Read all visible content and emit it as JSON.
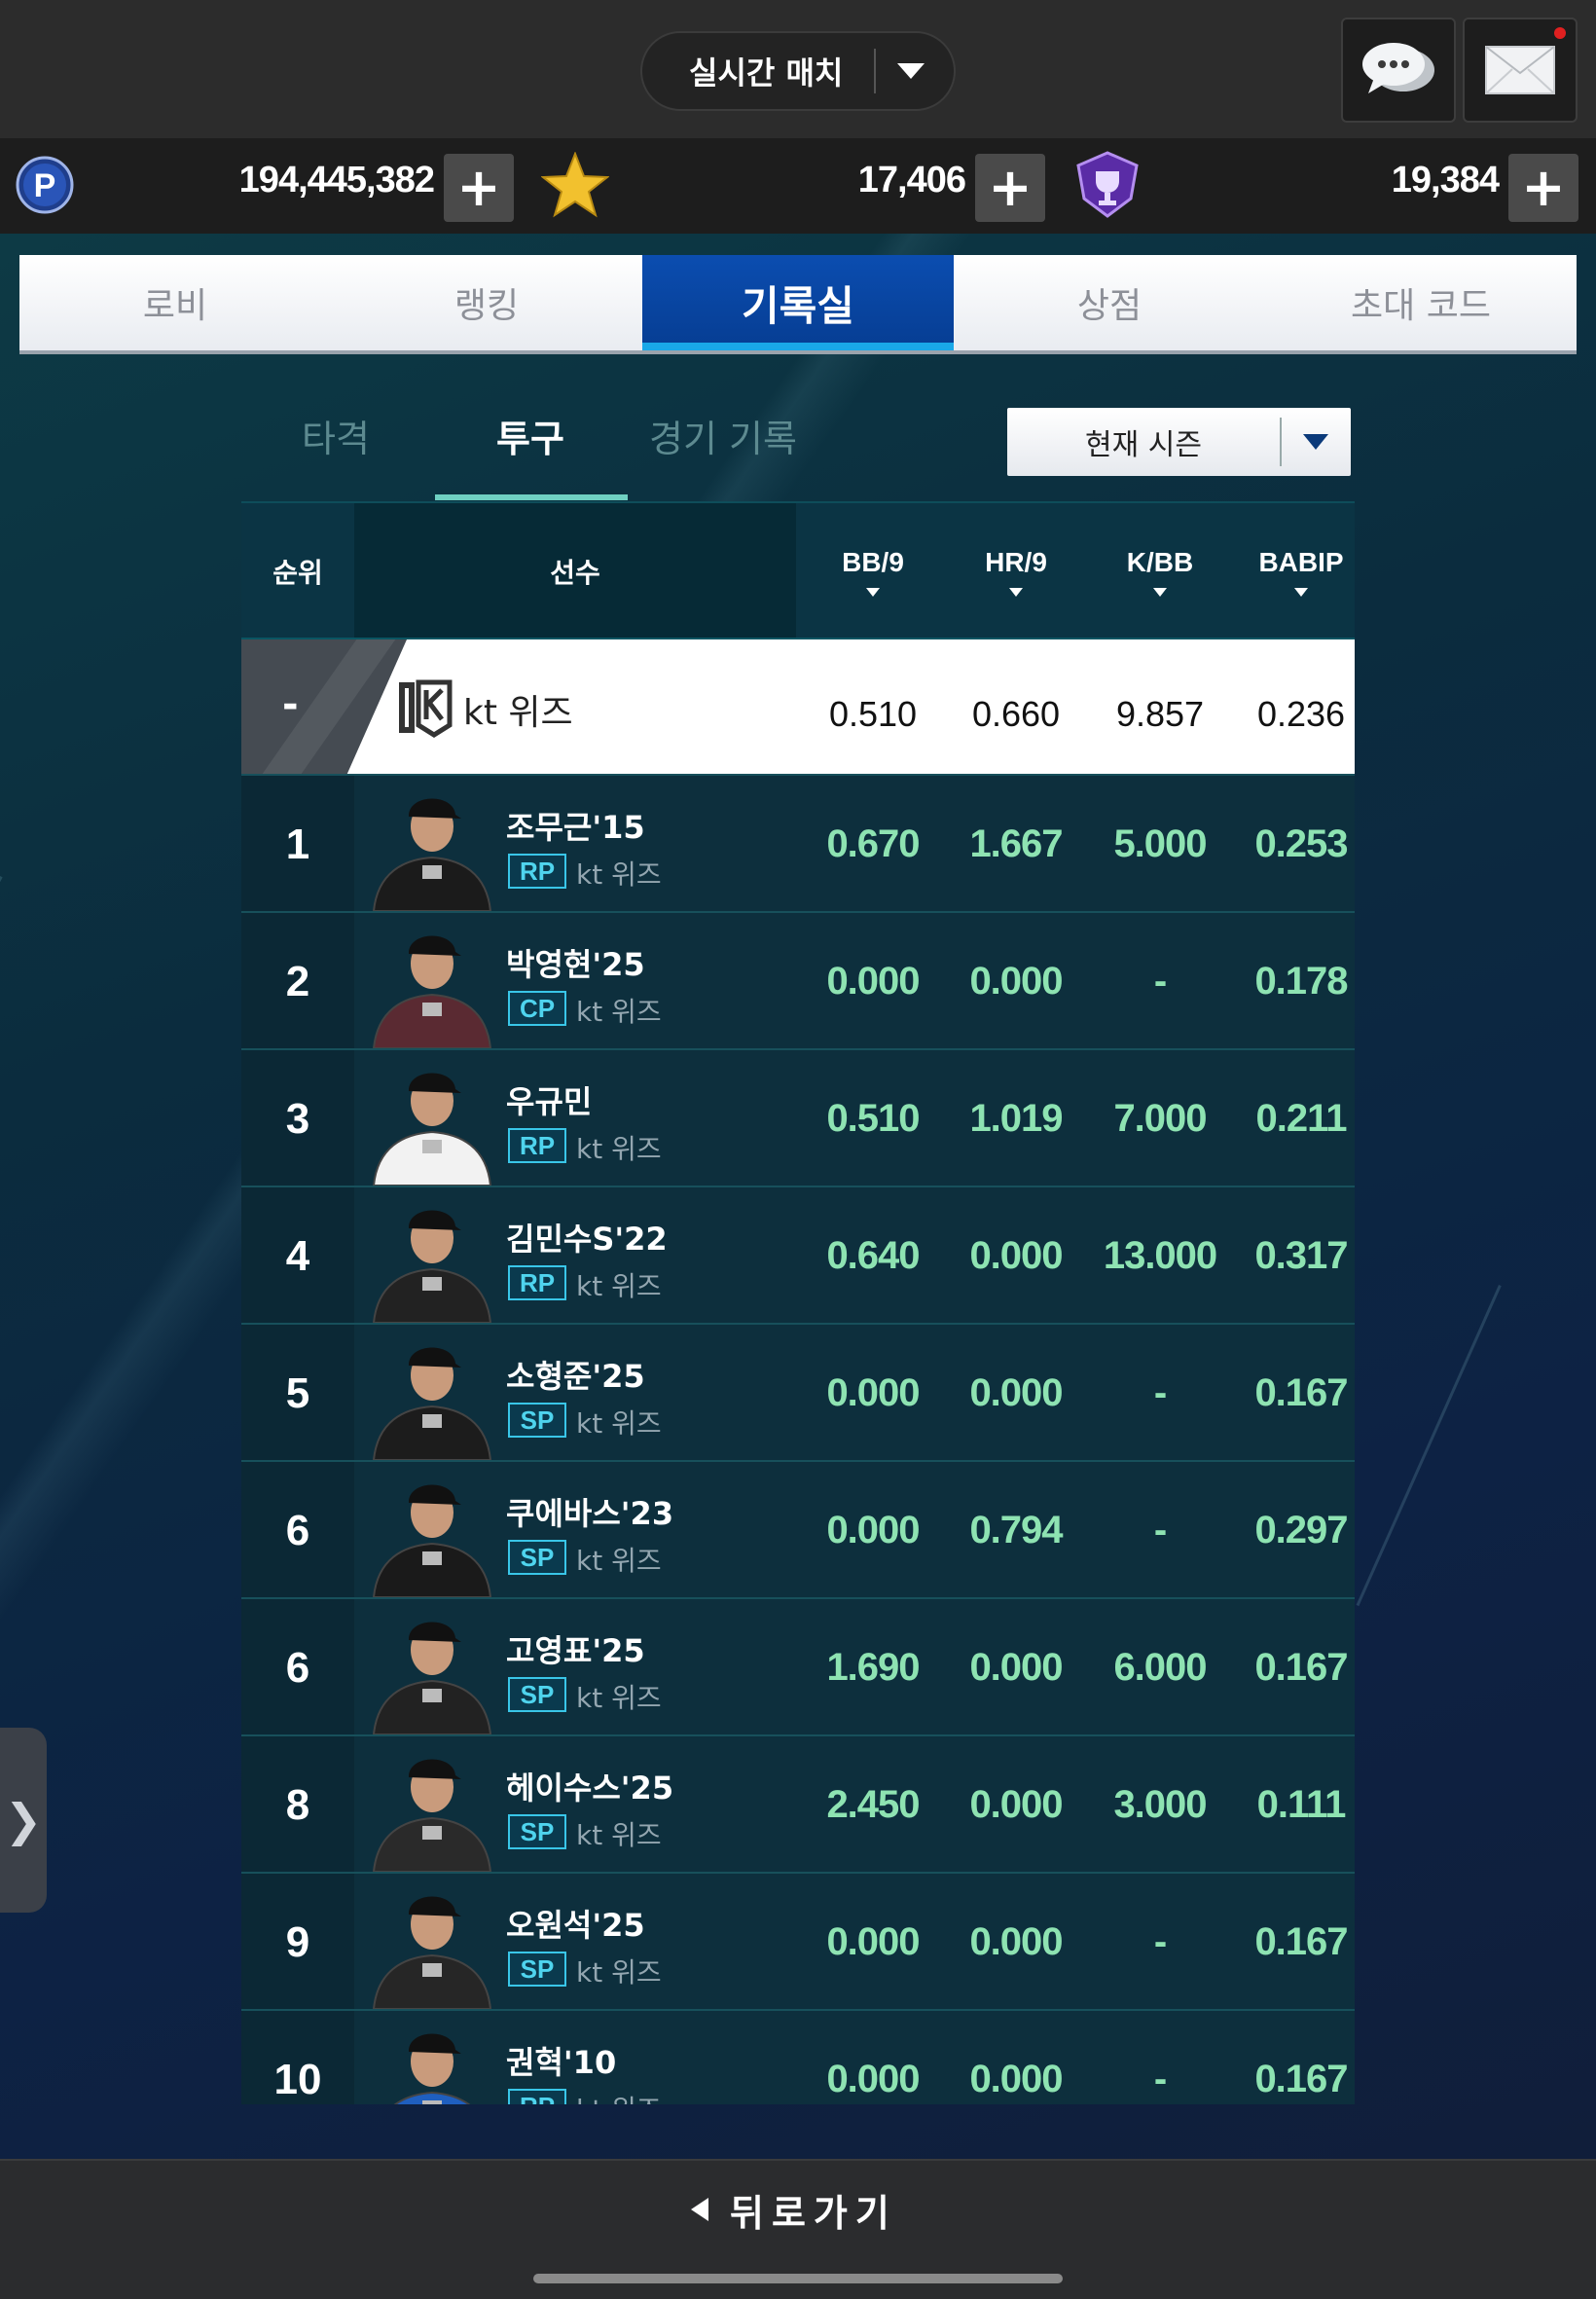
{
  "header": {
    "match_mode": "실시간 매치"
  },
  "currency": {
    "points": "194,445,382",
    "stars": "17,406",
    "trophies": "19,384"
  },
  "tabs": [
    {
      "label": "로비",
      "active": false
    },
    {
      "label": "랭킹",
      "active": false
    },
    {
      "label": "기록실",
      "active": true
    },
    {
      "label": "상점",
      "active": false
    },
    {
      "label": "초대 코드",
      "active": false
    }
  ],
  "subtabs": [
    {
      "label": "타격",
      "active": false
    },
    {
      "label": "투구",
      "active": true
    },
    {
      "label": "경기 기록",
      "active": false
    }
  ],
  "season_select": "현재 시즌",
  "table": {
    "headers": {
      "rank": "순위",
      "player": "선수",
      "bb9": "BB/9",
      "hr9": "HR/9",
      "kbb": "K/BB",
      "babip": "BABIP"
    },
    "team_row": {
      "rank": "-",
      "team": "kt 위즈",
      "bb9": "0.510",
      "hr9": "0.660",
      "kbb": "9.857",
      "babip": "0.236"
    },
    "rows": [
      {
        "rank": "1",
        "name": "조무근'15",
        "pos": "RP",
        "team": "kt 위즈",
        "bb9": "0.670",
        "hr9": "1.667",
        "kbb": "5.000",
        "babip": "0.253"
      },
      {
        "rank": "2",
        "name": "박영현'25",
        "pos": "CP",
        "team": "kt 위즈",
        "bb9": "0.000",
        "hr9": "0.000",
        "kbb": "-",
        "babip": "0.178"
      },
      {
        "rank": "3",
        "name": "우규민",
        "pos": "RP",
        "team": "kt 위즈",
        "bb9": "0.510",
        "hr9": "1.019",
        "kbb": "7.000",
        "babip": "0.211"
      },
      {
        "rank": "4",
        "name": "김민수S'22",
        "pos": "RP",
        "team": "kt 위즈",
        "bb9": "0.640",
        "hr9": "0.000",
        "kbb": "13.000",
        "babip": "0.317"
      },
      {
        "rank": "5",
        "name": "소형준'25",
        "pos": "SP",
        "team": "kt 위즈",
        "bb9": "0.000",
        "hr9": "0.000",
        "kbb": "-",
        "babip": "0.167"
      },
      {
        "rank": "6",
        "name": "쿠에바스'23",
        "pos": "SP",
        "team": "kt 위즈",
        "bb9": "0.000",
        "hr9": "0.794",
        "kbb": "-",
        "babip": "0.297"
      },
      {
        "rank": "6",
        "name": "고영표'25",
        "pos": "SP",
        "team": "kt 위즈",
        "bb9": "1.690",
        "hr9": "0.000",
        "kbb": "6.000",
        "babip": "0.167"
      },
      {
        "rank": "8",
        "name": "헤이수스'25",
        "pos": "SP",
        "team": "kt 위즈",
        "bb9": "2.450",
        "hr9": "0.000",
        "kbb": "3.000",
        "babip": "0.111"
      },
      {
        "rank": "9",
        "name": "오원석'25",
        "pos": "SP",
        "team": "kt 위즈",
        "bb9": "0.000",
        "hr9": "0.000",
        "kbb": "-",
        "babip": "0.167"
      },
      {
        "rank": "10",
        "name": "권혁'10",
        "pos": "RP",
        "team": "kt 위즈",
        "bb9": "0.000",
        "hr9": "0.000",
        "kbb": "-",
        "babip": "0.167"
      }
    ]
  },
  "footer": {
    "back_label": "뒤로가기"
  },
  "colors": {
    "accent": "#063d92",
    "stat_green": "#8ee3b2",
    "pos_badge": "#39c6e8"
  }
}
